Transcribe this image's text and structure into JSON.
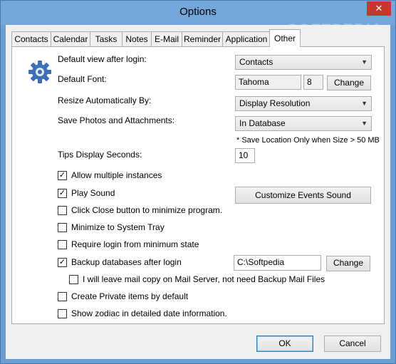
{
  "window": {
    "title": "Options",
    "close_glyph": "✕",
    "watermark": "SOFTPEDIA"
  },
  "tabs": [
    "Contacts",
    "Calendar",
    "Tasks",
    "Notes",
    "E-Mail",
    "Reminder",
    "Application",
    "Other"
  ],
  "active_tab": "Other",
  "other": {
    "default_view_label": "Default view after login:",
    "default_view_value": "Contacts",
    "default_font_label": "Default Font:",
    "font_name": "Tahoma",
    "font_size": "8",
    "font_change_label": "Change",
    "resize_label": "Resize Automatically By:",
    "resize_value": "Display Resolution",
    "save_photos_label": "Save Photos and Attachments:",
    "save_photos_value": "In Database",
    "save_note": "* Save Location Only when Size > 50 MB",
    "tips_label": "Tips Display Seconds:",
    "tips_value": "10",
    "customize_sound_label": "Customize Events Sound",
    "backup_path": "C:\\Softpedia",
    "backup_change_label": "Change",
    "checkboxes": [
      {
        "label": "Allow multiple instances",
        "checked": true
      },
      {
        "label": "Play Sound",
        "checked": true
      },
      {
        "label": "Click Close button to minimize program.",
        "checked": false
      },
      {
        "label": "Minimize to System Tray",
        "checked": false
      },
      {
        "label": "Require login from minimum state",
        "checked": false
      },
      {
        "label": "Backup databases after login",
        "checked": true
      },
      {
        "label": "I will leave mail copy on Mail Server, not need Backup Mail Files",
        "checked": false
      },
      {
        "label": "Create Private items by default",
        "checked": false
      },
      {
        "label": "Show zodiac in detailed date information.",
        "checked": false
      }
    ]
  },
  "footer": {
    "ok_label": "OK",
    "cancel_label": "Cancel"
  },
  "colors": {
    "titlebar": "#74a6d9",
    "close": "#c7372f",
    "gear": "#3b6fb6"
  },
  "icons": {
    "dropdown": "chevron-down-icon",
    "check": "checkmark-icon",
    "settings": "gear-icon"
  }
}
